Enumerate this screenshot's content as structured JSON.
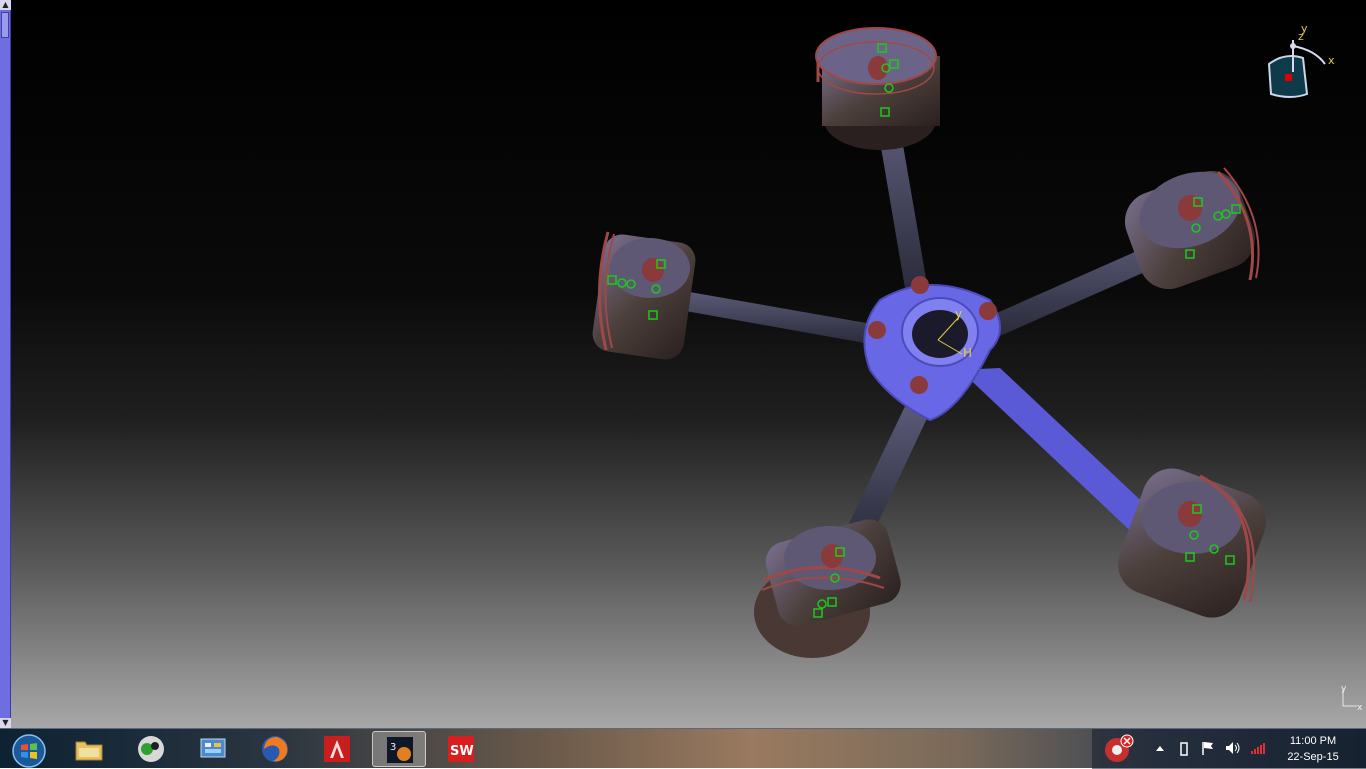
{
  "viewport": {
    "description_icon": "catia-3d-viewport",
    "axis_labels": {
      "compass_x": "x",
      "compass_y": "y",
      "compass_z": "z",
      "center_y": "y",
      "center_h": "H",
      "corner_y": "y",
      "corner_x": "x"
    }
  },
  "colors": {
    "crank_blue": "#6a6aee",
    "piston_body": "#5a4a48",
    "ring_red": "#a04848",
    "constraint_green": "#1ec81e",
    "compass_red": "#e00000"
  },
  "taskbar": {
    "buttons": [
      {
        "name": "start-button",
        "icon": "windows-orb-icon"
      },
      {
        "name": "explorer-button",
        "icon": "folder-icon"
      },
      {
        "name": "media-button",
        "icon": "media-player-icon"
      },
      {
        "name": "control-panel-button",
        "icon": "control-panel-icon"
      },
      {
        "name": "firefox-button",
        "icon": "firefox-icon"
      },
      {
        "name": "autocad-button",
        "icon": "autocad-icon"
      },
      {
        "name": "3dsmax-button",
        "icon": "3ds-icon"
      },
      {
        "name": "solidworks-button",
        "icon": "solidworks-icon"
      }
    ],
    "active_button": "3dsmax-button",
    "tray": {
      "time": "11:00 PM",
      "date": "22-Sep-15"
    }
  }
}
